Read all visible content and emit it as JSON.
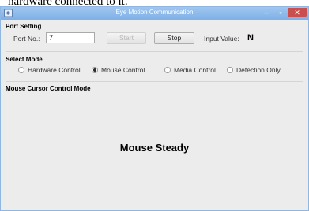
{
  "caption_above": "hardware connected to it.",
  "window": {
    "title": "Eye Motion Communication",
    "controls": {
      "minimize": "–",
      "maximize": "▫",
      "close": "✕"
    }
  },
  "port_setting": {
    "title": "Port Setting",
    "port_label": "Port No.:",
    "port_value": "7",
    "start_label": "Start",
    "stop_label": "Stop",
    "input_value_label": "Input Value:",
    "input_value": "N"
  },
  "select_mode": {
    "title": "Select Mode",
    "options": [
      {
        "label": "Hardware Control",
        "selected": false
      },
      {
        "label": "Mouse Control",
        "selected": true
      },
      {
        "label": "Media Control",
        "selected": false
      },
      {
        "label": "Detection Only",
        "selected": false
      }
    ]
  },
  "mode_panel": {
    "title": "Mouse Cursor Control Mode",
    "status": "Mouse Steady"
  }
}
